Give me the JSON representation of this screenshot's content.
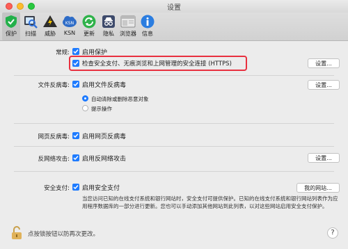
{
  "window": {
    "title": "设置"
  },
  "toolbar": {
    "items": [
      {
        "label": "保护",
        "icon": "shield-check-icon",
        "active": true
      },
      {
        "label": "扫描",
        "icon": "scan-magnifier-icon",
        "active": false
      },
      {
        "label": "威胁",
        "icon": "warning-triangle-icon",
        "active": false
      },
      {
        "label": "KSN",
        "icon": "ksn-cloud-icon",
        "active": false
      },
      {
        "label": "更新",
        "icon": "update-arrows-icon",
        "active": false
      },
      {
        "label": "隐私",
        "icon": "privacy-spy-icon",
        "active": false
      },
      {
        "label": "浏览器",
        "icon": "browser-window-icon",
        "active": false
      },
      {
        "label": "信息",
        "icon": "info-icon",
        "active": false
      }
    ]
  },
  "general": {
    "label": "常规:",
    "enable_protection": "启用保护",
    "secure_connection": "检查安全支付、无痕浏览和上网管理的安全连接 (HTTPS)",
    "settings_button": "设置..."
  },
  "file_av": {
    "label": "文件反病毒:",
    "enable": "启用文件反病毒",
    "settings_button": "设置...",
    "radio_auto": "自动清除或删除恶意对象",
    "radio_prompt": "提示操作"
  },
  "web_av": {
    "label": "网页反病毒:",
    "enable": "启用网页反病毒"
  },
  "network_attack": {
    "label": "反网络攻击:",
    "enable": "启用反网络攻击",
    "settings_button": "设置..."
  },
  "safe_money": {
    "label": "安全支付:",
    "enable": "启用安全支付",
    "my_sites_button": "我的网站...",
    "description": "当您访问已知的在线支付系统和银行网站时，安全支付可提供保护。已知的在线支付系统和银行网站列表作为应用程序数据库的一部分进行更新。您也可以手动添加其他网站到此列表，以对这些网站启用安全支付保护。"
  },
  "footer": {
    "lock_text": "点按锁按钮以防再次更改。",
    "help": "?"
  },
  "colors": {
    "accent": "#1e7bff",
    "highlight": "#e8303f"
  }
}
